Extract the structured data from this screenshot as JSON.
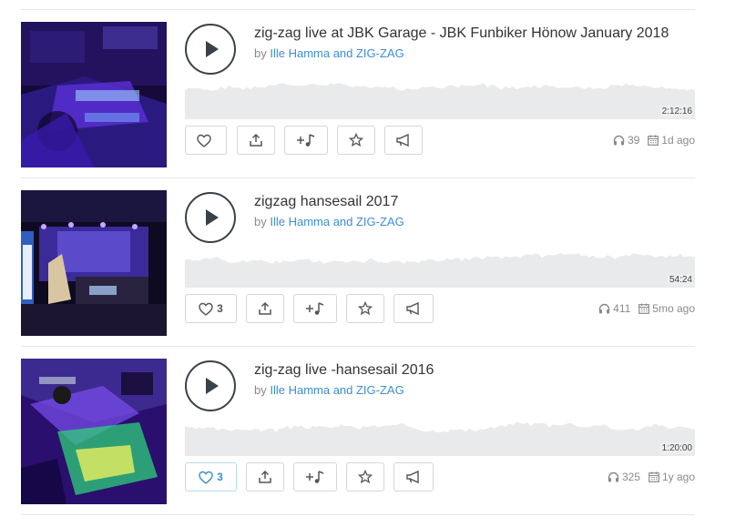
{
  "tracks": [
    {
      "title": "zig-zag live at JBK Garage - JBK Funbiker Hönow January 2018",
      "by_prefix": "by ",
      "artist": "Ille Hamma and ZIG-ZAG",
      "duration": "2:12:16",
      "likes": "",
      "plays": "39",
      "age": "1d ago",
      "liked": false,
      "cover_palette": [
        "#1a0d4a",
        "#3b22a8",
        "#7c3ff0",
        "#2bb0ff"
      ]
    },
    {
      "title": "zigzag hansesail 2017",
      "by_prefix": "by ",
      "artist": "Ille Hamma and ZIG-ZAG",
      "duration": "54:24",
      "likes": "3",
      "plays": "411",
      "age": "5mo ago",
      "liked": false,
      "cover_palette": [
        "#140c2e",
        "#5a3bc4",
        "#2d7be0",
        "#e8d0ff"
      ]
    },
    {
      "title": "zig-zag live -hansesail 2016",
      "by_prefix": "by ",
      "artist": "Ille Hamma and ZIG-ZAG",
      "duration": "1:20:00",
      "likes": "3",
      "plays": "325",
      "age": "1y ago",
      "liked": true,
      "cover_palette": [
        "#2a1070",
        "#6a2fd8",
        "#27c46a",
        "#e3f05a"
      ]
    }
  ],
  "icons": {
    "play": "play-icon",
    "like": "heart-icon",
    "share": "share-icon",
    "add": "add-to-playlist-icon",
    "favorite": "star-icon",
    "promote": "megaphone-icon",
    "plays": "headphones-icon",
    "date": "calendar-icon"
  },
  "colors": {
    "accent": "#3b8ed4",
    "waveform": "#e8eaec",
    "border": "#d6d6d6"
  }
}
